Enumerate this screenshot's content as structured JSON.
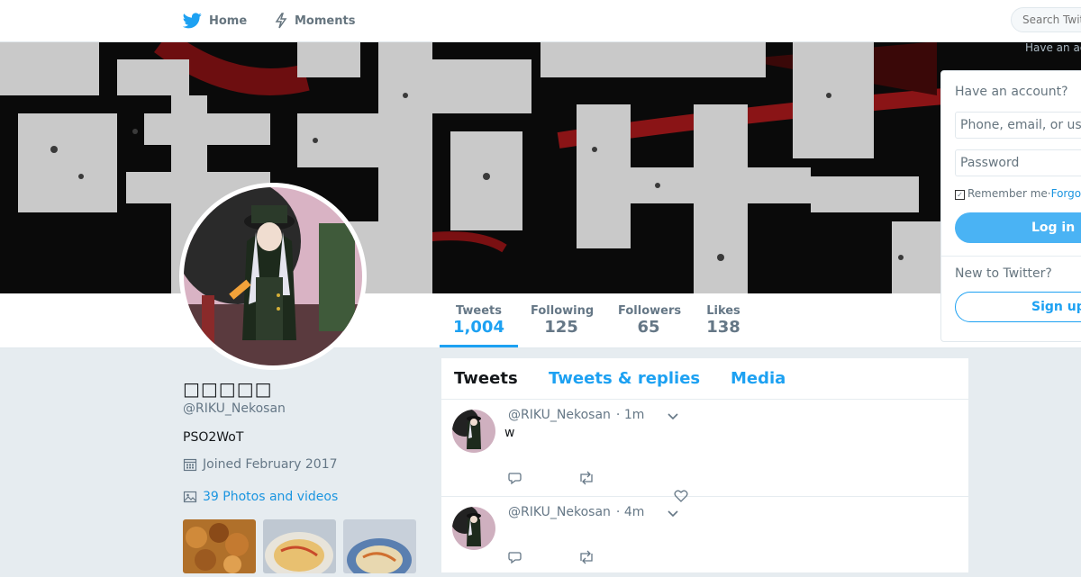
{
  "colors": {
    "accent": "#1da1f2",
    "link": "#1b95e0",
    "background": "#e6ecf0",
    "muted": "#657786"
  },
  "nav": {
    "home_label": "Home",
    "home_icon": "twitter-bird-icon",
    "moments_label": "Moments",
    "moments_icon": "lightning-icon",
    "search_placeholder": "Search Twitter",
    "have_account_label": "Have an account?"
  },
  "profile_nav": {
    "stats": [
      {
        "label": "Tweets",
        "value": "1,004",
        "active": true
      },
      {
        "label": "Following",
        "value": "125"
      },
      {
        "label": "Followers",
        "value": "65"
      },
      {
        "label": "Likes",
        "value": "138"
      }
    ]
  },
  "profile": {
    "name": "□□□□□",
    "handle": "@RIKU_Nekosan",
    "bio": "PSO2WoT",
    "joined": "Joined February 2017",
    "photos_link": "39 Photos and videos"
  },
  "timeline": {
    "tabs": [
      "Tweets",
      "Tweets & replies",
      "Media"
    ],
    "tweets": [
      {
        "handle": "@RIKU_Nekosan",
        "time": "· 1m",
        "text": "w"
      },
      {
        "handle": "@RIKU_Nekosan",
        "time": "· 4m",
        "text": ""
      }
    ]
  },
  "login": {
    "title": "Have an account?",
    "phone_placeholder": "Phone, email, or username",
    "password_placeholder": "Password",
    "remember_label": "Remember me",
    "separator": " · ",
    "forgot_label": "Forgot password?",
    "login_button": "Log in",
    "new_to_twitter": "New to Twitter?",
    "signup_button": "Sign up"
  }
}
